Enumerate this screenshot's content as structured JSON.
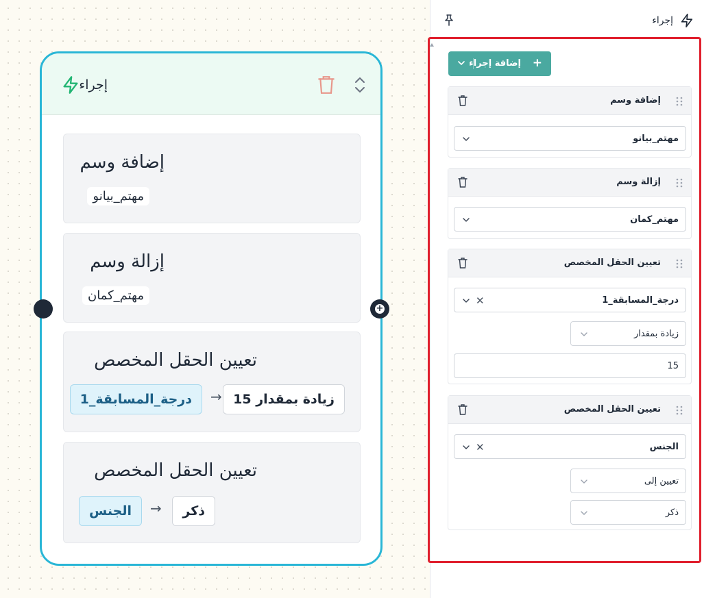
{
  "canvas": {
    "node": {
      "title": "إجراء",
      "cards": [
        {
          "title": "إضافة وسم",
          "chip": "مهتم_بيانو"
        },
        {
          "title": "إزالة وسم",
          "chip": "مهتم_كمان"
        },
        {
          "title": "تعيين الحقل المخصص",
          "field": "درجة_المسابقة_1",
          "arrow": "→",
          "value": "زيادة بمقدار 15"
        },
        {
          "title": "تعيين الحقل المخصص",
          "field": "الجنس",
          "arrow": "→",
          "value": "ذكر"
        }
      ]
    },
    "handle_right_glyph": "+"
  },
  "panel": {
    "title": "إجراء",
    "add_button": {
      "plus": "+",
      "label": "إضافة إجراء"
    },
    "actions": [
      {
        "title": "إضافة وسم",
        "select": "مهتم_بيانو"
      },
      {
        "title": "إزالة وسم",
        "select": "مهتم_كمان"
      },
      {
        "title": "تعيين الحقل المخصص",
        "field": "درجة_المسابقة_1",
        "operation": "زيادة بمقدار",
        "value": "15"
      },
      {
        "title": "تعيين الحقل المخصص",
        "field": "الجنس",
        "operation": "تعيين إلى",
        "value": "ذكر"
      }
    ],
    "clear_glyph": "✕"
  },
  "colors": {
    "node_border": "#29b6d6",
    "node_header_bg": "#ecfaf3",
    "accent_button": "#4aa9a0",
    "highlight_outline": "#e0202e",
    "bolt_green": "#22b573"
  }
}
